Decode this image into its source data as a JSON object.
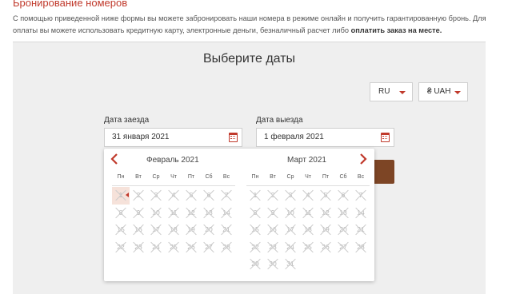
{
  "page": {
    "title": "Бронирование номеров",
    "intro_text": "С помощью приведенной ниже формы вы можете забронировать наши номера в режиме онлайн и получить гарантированную бронь. Для оплаты вы можете использовать кредитную карту, электронные деньги, безналичный расчет либо ",
    "intro_bold": "оплатить заказ на месте."
  },
  "panel": {
    "title": "Выберите даты",
    "language": {
      "value": "RU"
    },
    "currency": {
      "value": "₴ UAH"
    }
  },
  "checkin": {
    "label": "Дата заезда",
    "value": "31 января 2021"
  },
  "checkout": {
    "label": "Дата выезда",
    "value": "1 февраля 2021"
  },
  "calendar": {
    "prev_icon": "chevron-left-icon",
    "next_icon": "chevron-right-icon",
    "weekdays": [
      "Пн",
      "Вт",
      "Ср",
      "Чт",
      "Пт",
      "Сб",
      "Вс"
    ],
    "months": [
      {
        "title": "Февраль 2021",
        "days": [
          "1",
          "2",
          "3",
          "4",
          "5",
          "6",
          "7",
          "8",
          "9",
          "10",
          "11",
          "12",
          "13",
          "14",
          "15",
          "16",
          "17",
          "18",
          "19",
          "20",
          "21",
          "22",
          "23",
          "24",
          "25",
          "26",
          "27",
          "28"
        ]
      },
      {
        "title": "Март 2021",
        "days": [
          "1",
          "2",
          "3",
          "4",
          "5",
          "6",
          "7",
          "8",
          "9",
          "10",
          "11",
          "12",
          "13",
          "14",
          "15",
          "16",
          "17",
          "18",
          "19",
          "20",
          "21",
          "22",
          "23",
          "24",
          "25",
          "26",
          "27",
          "28",
          "29",
          "30",
          "31"
        ]
      }
    ]
  },
  "colors": {
    "accent": "#c0392b",
    "button": "#7d4525",
    "selected_day": "#f6e2da"
  }
}
